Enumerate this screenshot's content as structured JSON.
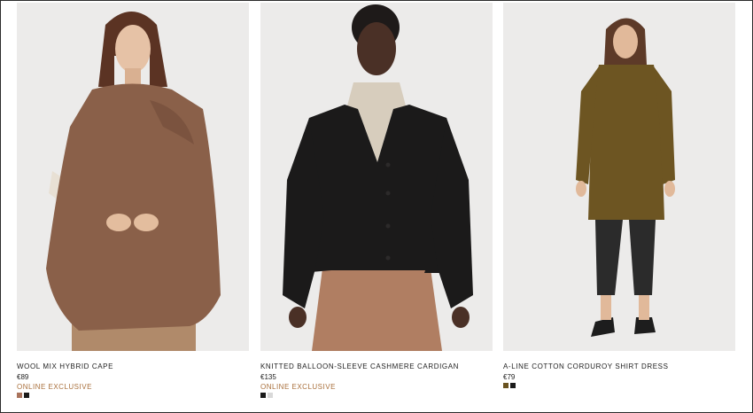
{
  "products": [
    {
      "name": "WOOL MIX HYBRID CAPE",
      "price": "€89",
      "badge": "ONLINE EXCLUSIVE",
      "swatches": [
        "#a9735c",
        "#1b1b1b"
      ]
    },
    {
      "name": "KNITTED BALLOON-SLEEVE CASHMERE CARDIGAN",
      "price": "€135",
      "badge": "ONLINE EXCLUSIVE",
      "swatches": [
        "#1b1b1b",
        "#d9d9d9"
      ]
    },
    {
      "name": "A-LINE COTTON CORDUROY SHIRT DRESS",
      "price": "€79",
      "swatches": [
        "#6a5320",
        "#1b1b1b"
      ]
    }
  ],
  "colors": {
    "badge": "#a9703c",
    "photo_background": "#ececeb"
  }
}
